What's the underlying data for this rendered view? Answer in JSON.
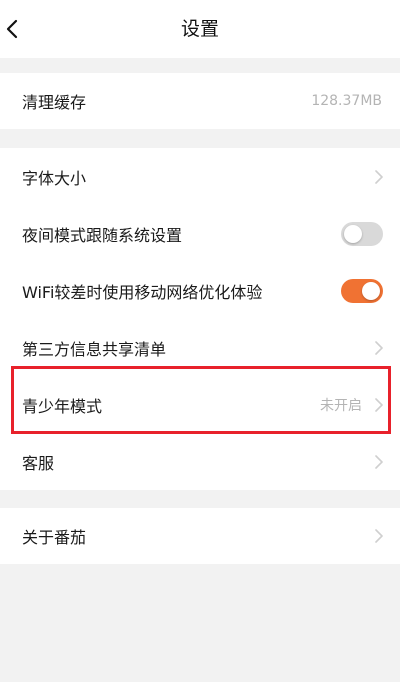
{
  "header": {
    "title": "设置",
    "back_icon": "chevron-left-icon"
  },
  "cache": {
    "label": "清理缓存",
    "value": "128.37MB"
  },
  "settings": {
    "font_size": {
      "label": "字体大小"
    },
    "night_mode": {
      "label": "夜间模式跟随系统设置",
      "toggle_on": false
    },
    "wifi_optimize": {
      "label": "WiFi较差时使用移动网络优化体验",
      "toggle_on": true
    },
    "third_party": {
      "label": "第三方信息共享清单"
    },
    "teen_mode": {
      "label": "青少年模式",
      "value": "未开启"
    },
    "customer_service": {
      "label": "客服"
    }
  },
  "about": {
    "label": "关于番茄"
  },
  "colors": {
    "toggle_on": "#f07233",
    "toggle_off": "#d9d9d9",
    "highlight_border": "#e8212b",
    "background": "#f2f2f2"
  }
}
